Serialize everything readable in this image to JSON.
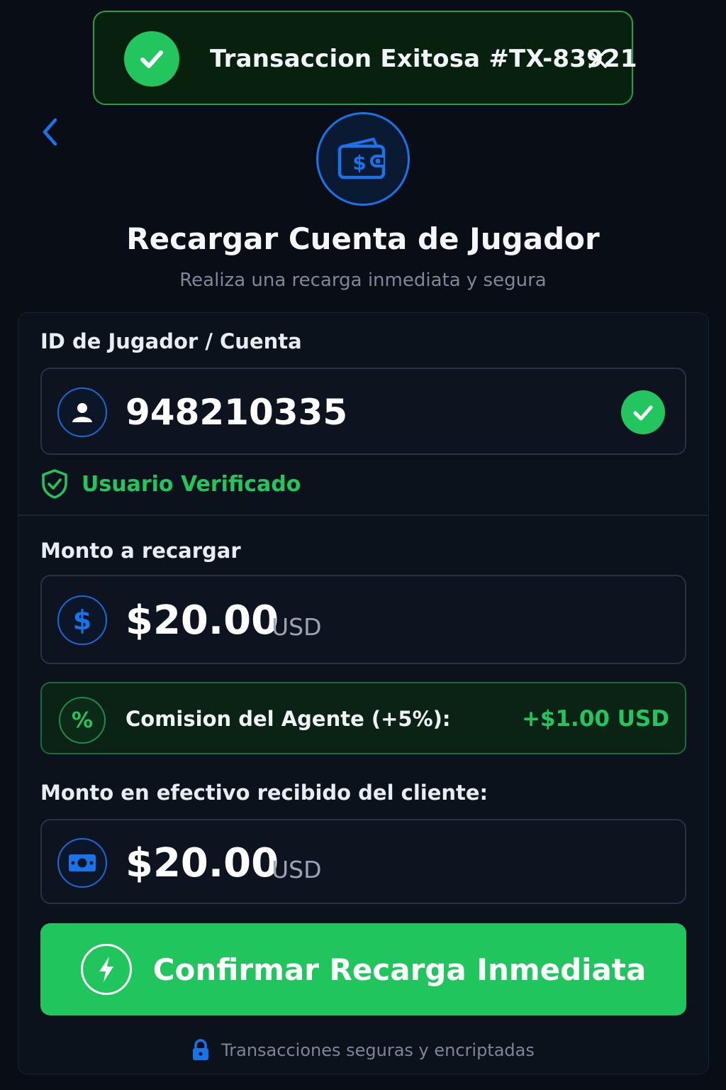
{
  "toast": {
    "message": "Transaccion Exitosa #TX-83921",
    "success_color": "#22c55e",
    "icons": {
      "status": "check-circle-icon",
      "close": "close-icon"
    }
  },
  "header": {
    "back_icon": "chevron-left-icon",
    "badge_icon": "wallet-dollar-icon",
    "title": "Recargar Cuenta de Jugador",
    "subtitle": "Realiza una recarga inmediata y segura"
  },
  "player": {
    "label": "ID de Jugador / Cuenta",
    "id_value": "948210335",
    "icon": "user-icon",
    "status_icon": "check-circle-icon",
    "verified_text": "Usuario Verificado",
    "verified_icon": "shield-check-icon"
  },
  "amount": {
    "label": "Monto a recargar",
    "value": "$20.00",
    "currency": "USD",
    "icon": "dollar-circle-icon"
  },
  "commission": {
    "label": "Comision del Agente (+5%):",
    "value": "+$1.00 USD",
    "icon_text": "%",
    "icon": "percent-icon"
  },
  "cash": {
    "label": "Monto en efectivo recibido del cliente:",
    "value": "$20.00",
    "currency": "USD",
    "icon": "banknote-icon"
  },
  "confirm": {
    "label": "Confirmar Recarga Inmediata",
    "icon": "lightning-icon",
    "color": "#21c55d"
  },
  "footer": {
    "secure_text": "Transacciones seguras y encriptadas",
    "icon": "lock-icon"
  },
  "colors": {
    "background": "#080d16",
    "accent_blue": "#1a73e8",
    "success_green": "#22c55e"
  }
}
